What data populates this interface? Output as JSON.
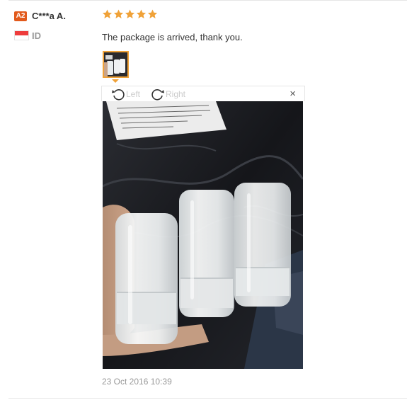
{
  "buyer": {
    "level_badge": "A2",
    "name": "C***a A.",
    "country_code": "ID",
    "flag_icon": "flag-indonesia-icon",
    "badge_color": "#e25a1c"
  },
  "review": {
    "rating": 5,
    "rating_max": 5,
    "star_color": "#f0a238",
    "text": "The package is arrived, thank you.",
    "date": "23 Oct 2016 10:39"
  },
  "viewer": {
    "rotate_left_label": "Left",
    "rotate_right_label": "Right",
    "rotate_left_icon": "rotate-left-icon",
    "rotate_right_icon": "rotate-right-icon",
    "close_label": "×",
    "photo_subject": "photo-of-clear-deodorant-tubes-icon"
  }
}
